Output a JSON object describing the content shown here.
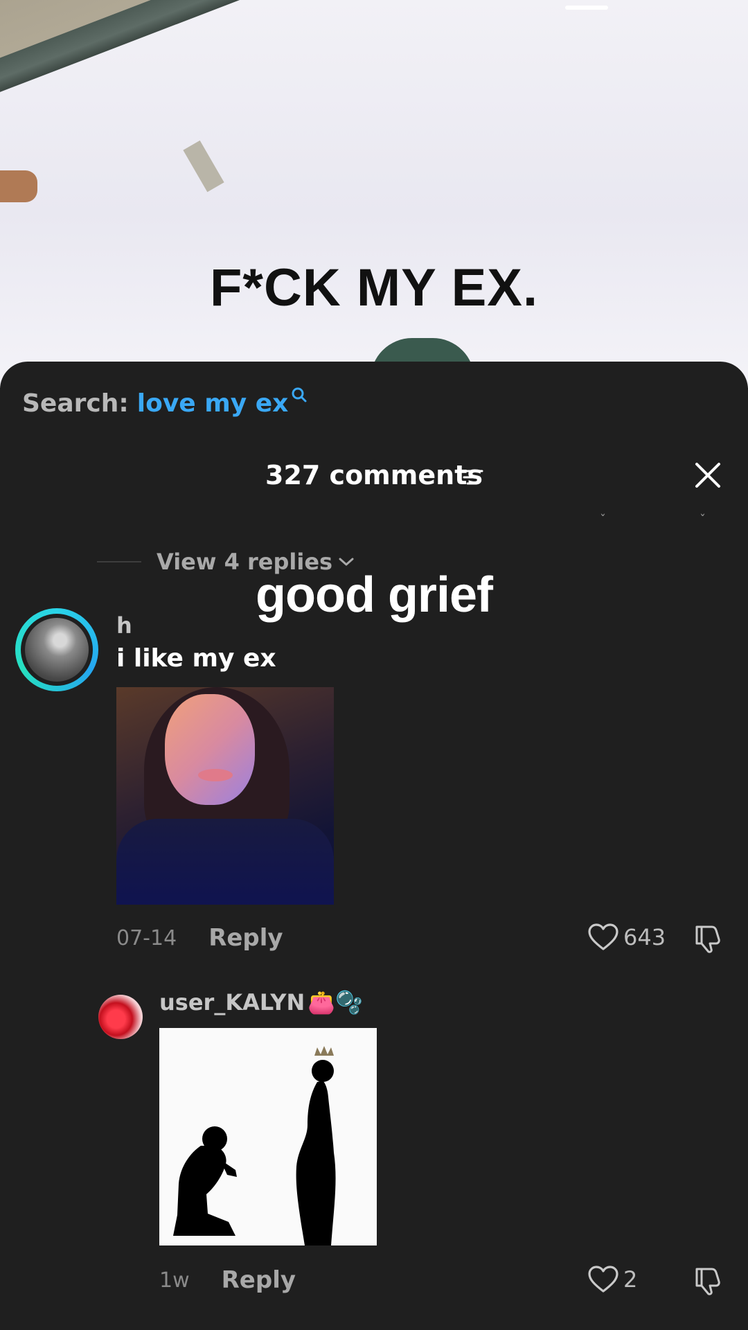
{
  "video": {
    "overlay_text": "F*CK MY EX."
  },
  "search": {
    "label": "Search:",
    "query": "love my ex"
  },
  "header": {
    "comments_count": "327 comments"
  },
  "thread": {
    "view_replies_label": "View 4 replies"
  },
  "caption": "good grief",
  "comments": [
    {
      "username": "h",
      "text": "i like my ex",
      "date": "07-14",
      "reply_label": "Reply",
      "likes": "643"
    },
    {
      "username": "user_KALYN",
      "username_emojis": "👛🫧",
      "date": "1w",
      "reply_label": "Reply",
      "likes": "2"
    }
  ],
  "colors": {
    "sheet_bg": "#1f1f1f",
    "search_query": "#3aa8f5",
    "avatar_ring": "#2ad4e8"
  },
  "icons": [
    "search-icon",
    "filter-icon",
    "close-icon",
    "chevron-down-icon",
    "heart-icon",
    "dislike-icon"
  ]
}
